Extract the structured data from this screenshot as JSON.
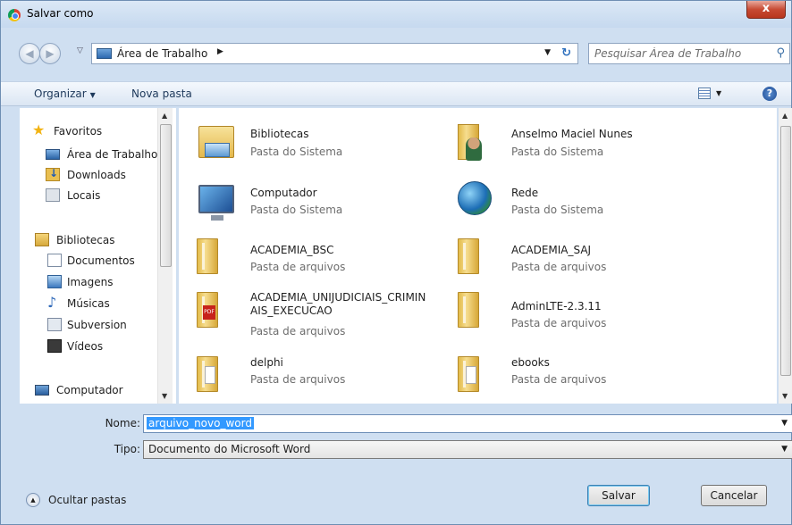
{
  "window": {
    "title": "Salvar como",
    "close_label": "x"
  },
  "address": {
    "breadcrumb": "Área de Trabalho",
    "search_placeholder": "Pesquisar Área de Trabalho"
  },
  "toolbar": {
    "organize_label": "Organizar",
    "new_folder_label": "Nova pasta",
    "help_label": "?"
  },
  "nav_pane": {
    "items": [
      {
        "label": "Favoritos",
        "icon": "star-icon"
      },
      {
        "label": "Área de Trabalho",
        "icon": "desktop-icon"
      },
      {
        "label": "Downloads",
        "icon": "downloads-icon"
      },
      {
        "label": "Locais",
        "icon": "places-icon"
      },
      {
        "label": "Bibliotecas",
        "icon": "libraries-icon"
      },
      {
        "label": "Documentos",
        "icon": "documents-icon"
      },
      {
        "label": "Imagens",
        "icon": "pictures-icon"
      },
      {
        "label": "Músicas",
        "icon": "music-icon"
      },
      {
        "label": "Subversion",
        "icon": "subversion-icon"
      },
      {
        "label": "Vídeos",
        "icon": "videos-icon"
      },
      {
        "label": "Computador",
        "icon": "computer-icon"
      }
    ]
  },
  "files": [
    {
      "name": "Bibliotecas",
      "type": "Pasta do Sistema",
      "icon": "libraries-icon"
    },
    {
      "name": "Anselmo Maciel Nunes",
      "type": "Pasta do Sistema",
      "icon": "user-folder-icon"
    },
    {
      "name": "Computador",
      "type": "Pasta do Sistema",
      "icon": "computer-icon"
    },
    {
      "name": "Rede",
      "type": "Pasta do Sistema",
      "icon": "network-icon"
    },
    {
      "name": "ACADEMIA_BSC",
      "type": "Pasta de arquivos",
      "icon": "folder-icon"
    },
    {
      "name": "ACADEMIA_SAJ",
      "type": "Pasta de arquivos",
      "icon": "folder-icon"
    },
    {
      "name": "ACADEMIA_UNIJUDICIAIS_CRIMINAIS_EXECUCAO",
      "name_line1": "ACADEMIA_UNIJUDICIAIS_CRIMIN",
      "name_line2": "AIS_EXECUCAO",
      "type": "Pasta de arquivos",
      "icon": "pdf-folder-icon"
    },
    {
      "name": "AdminLTE-2.3.11",
      "type": "Pasta de arquivos",
      "icon": "folder-icon"
    },
    {
      "name": "delphi",
      "type": "Pasta de arquivos",
      "icon": "document-folder-icon"
    },
    {
      "name": "ebooks",
      "type": "Pasta de arquivos",
      "icon": "document-folder-icon"
    }
  ],
  "form": {
    "name_label": "Nome:",
    "name_value": "arquivo_novo_word",
    "type_label": "Tipo:",
    "type_value": "Documento do Microsoft Word"
  },
  "footer": {
    "hide_folders_label": "Ocultar pastas",
    "save_label": "Salvar",
    "cancel_label": "Cancelar"
  }
}
